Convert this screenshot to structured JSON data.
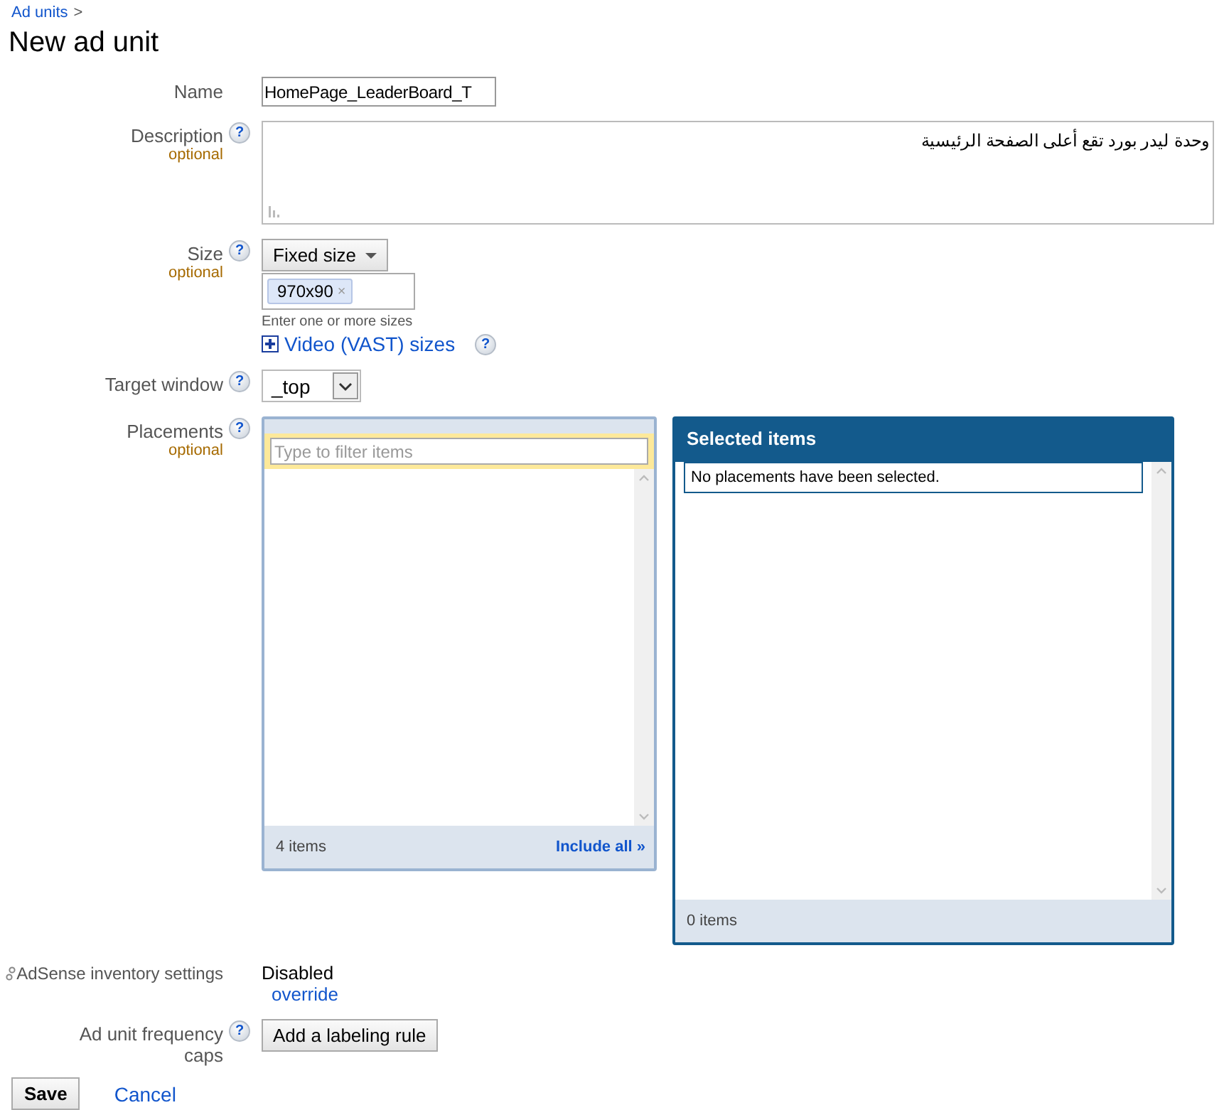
{
  "breadcrumb": {
    "link": "Ad units",
    "separator": ">"
  },
  "title": "New ad unit",
  "fields": [
    {
      "kind": "text",
      "label": "Name",
      "value": "HomePage_LeaderBoard_T"
    },
    {
      "kind": "textarea",
      "label": "Description",
      "help": "?",
      "optional": "optional",
      "value": "وحدة ليدر بورد تقع أعلى الصفحة الرئيسية"
    },
    {
      "kind": "size",
      "label": "Size",
      "help": "?",
      "optional": "optional",
      "dropdown": "Fixed size",
      "tags": [
        {
          "text": "970x90",
          "remove": "×"
        }
      ],
      "hint": "Enter one or more sizes",
      "video_link": "Video (VAST) sizes",
      "video_help": "?"
    },
    {
      "kind": "select",
      "label": "Target window",
      "help": "?",
      "value": "_top"
    },
    {
      "kind": "placements",
      "label": "Placements",
      "help": "?",
      "optional": "optional",
      "filter_placeholder": "Type to filter items",
      "available_count": "4 items",
      "include_all": "Include all »",
      "selected_title": "Selected items",
      "selected_empty": "No placements have been selected.",
      "selected_count": "0 items"
    },
    {
      "kind": "status",
      "label": "AdSense inventory settings",
      "value": "Disabled",
      "link": "override"
    },
    {
      "kind": "button",
      "label": "Ad unit frequency caps",
      "help": "?",
      "button": "Add a labeling rule"
    }
  ],
  "actions": {
    "save": "Save",
    "cancel": "Cancel"
  }
}
